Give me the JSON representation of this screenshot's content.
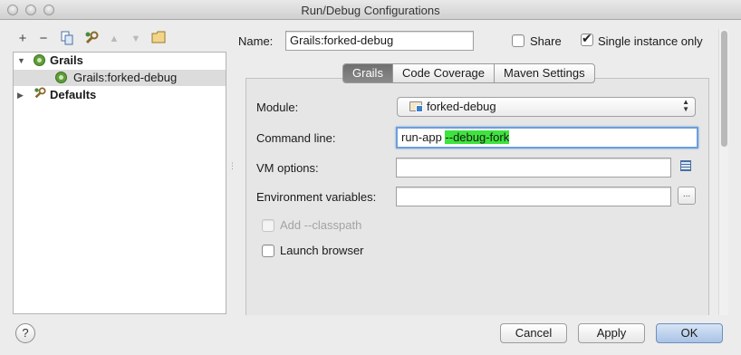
{
  "window": {
    "title": "Run/Debug Configurations"
  },
  "toolbar": {
    "add_icon": "plus-icon",
    "remove_icon": "minus-icon",
    "copy_icon": "copy-icon",
    "edit_defaults_icon": "wrench-icon",
    "move_up_icon": "arrow-up-icon",
    "move_down_icon": "arrow-down-icon",
    "folder_icon": "folder-icon"
  },
  "tree": {
    "items": [
      {
        "label": "Grails",
        "expanded": true,
        "level": 0
      },
      {
        "label": "Grails:forked-debug",
        "level": 1,
        "selected": true
      },
      {
        "label": "Defaults",
        "expanded": false,
        "level": 0
      }
    ]
  },
  "header": {
    "name_label": "Name:",
    "name_value": "Grails:forked-debug",
    "share_label": "Share",
    "share_checked": false,
    "single_instance_label": "Single instance only",
    "single_instance_checked": true
  },
  "tabs": [
    {
      "label": "Grails",
      "active": true
    },
    {
      "label": "Code Coverage",
      "active": false
    },
    {
      "label": "Maven Settings",
      "active": false
    }
  ],
  "form": {
    "module_label": "Module:",
    "module_value": "forked-debug",
    "command_line_label": "Command line:",
    "command_line_prefix": "run-app ",
    "command_line_highlight": "--debug-fork",
    "vm_options_label": "VM options:",
    "vm_options_value": "",
    "env_vars_label": "Environment variables:",
    "env_vars_value": "",
    "env_vars_button": "...",
    "add_classpath_label": "Add --classpath",
    "add_classpath_checked": false,
    "add_classpath_enabled": false,
    "launch_browser_label": "Launch browser",
    "launch_browser_checked": false
  },
  "footer": {
    "help_label": "?",
    "cancel_label": "Cancel",
    "apply_label": "Apply",
    "ok_label": "OK"
  }
}
